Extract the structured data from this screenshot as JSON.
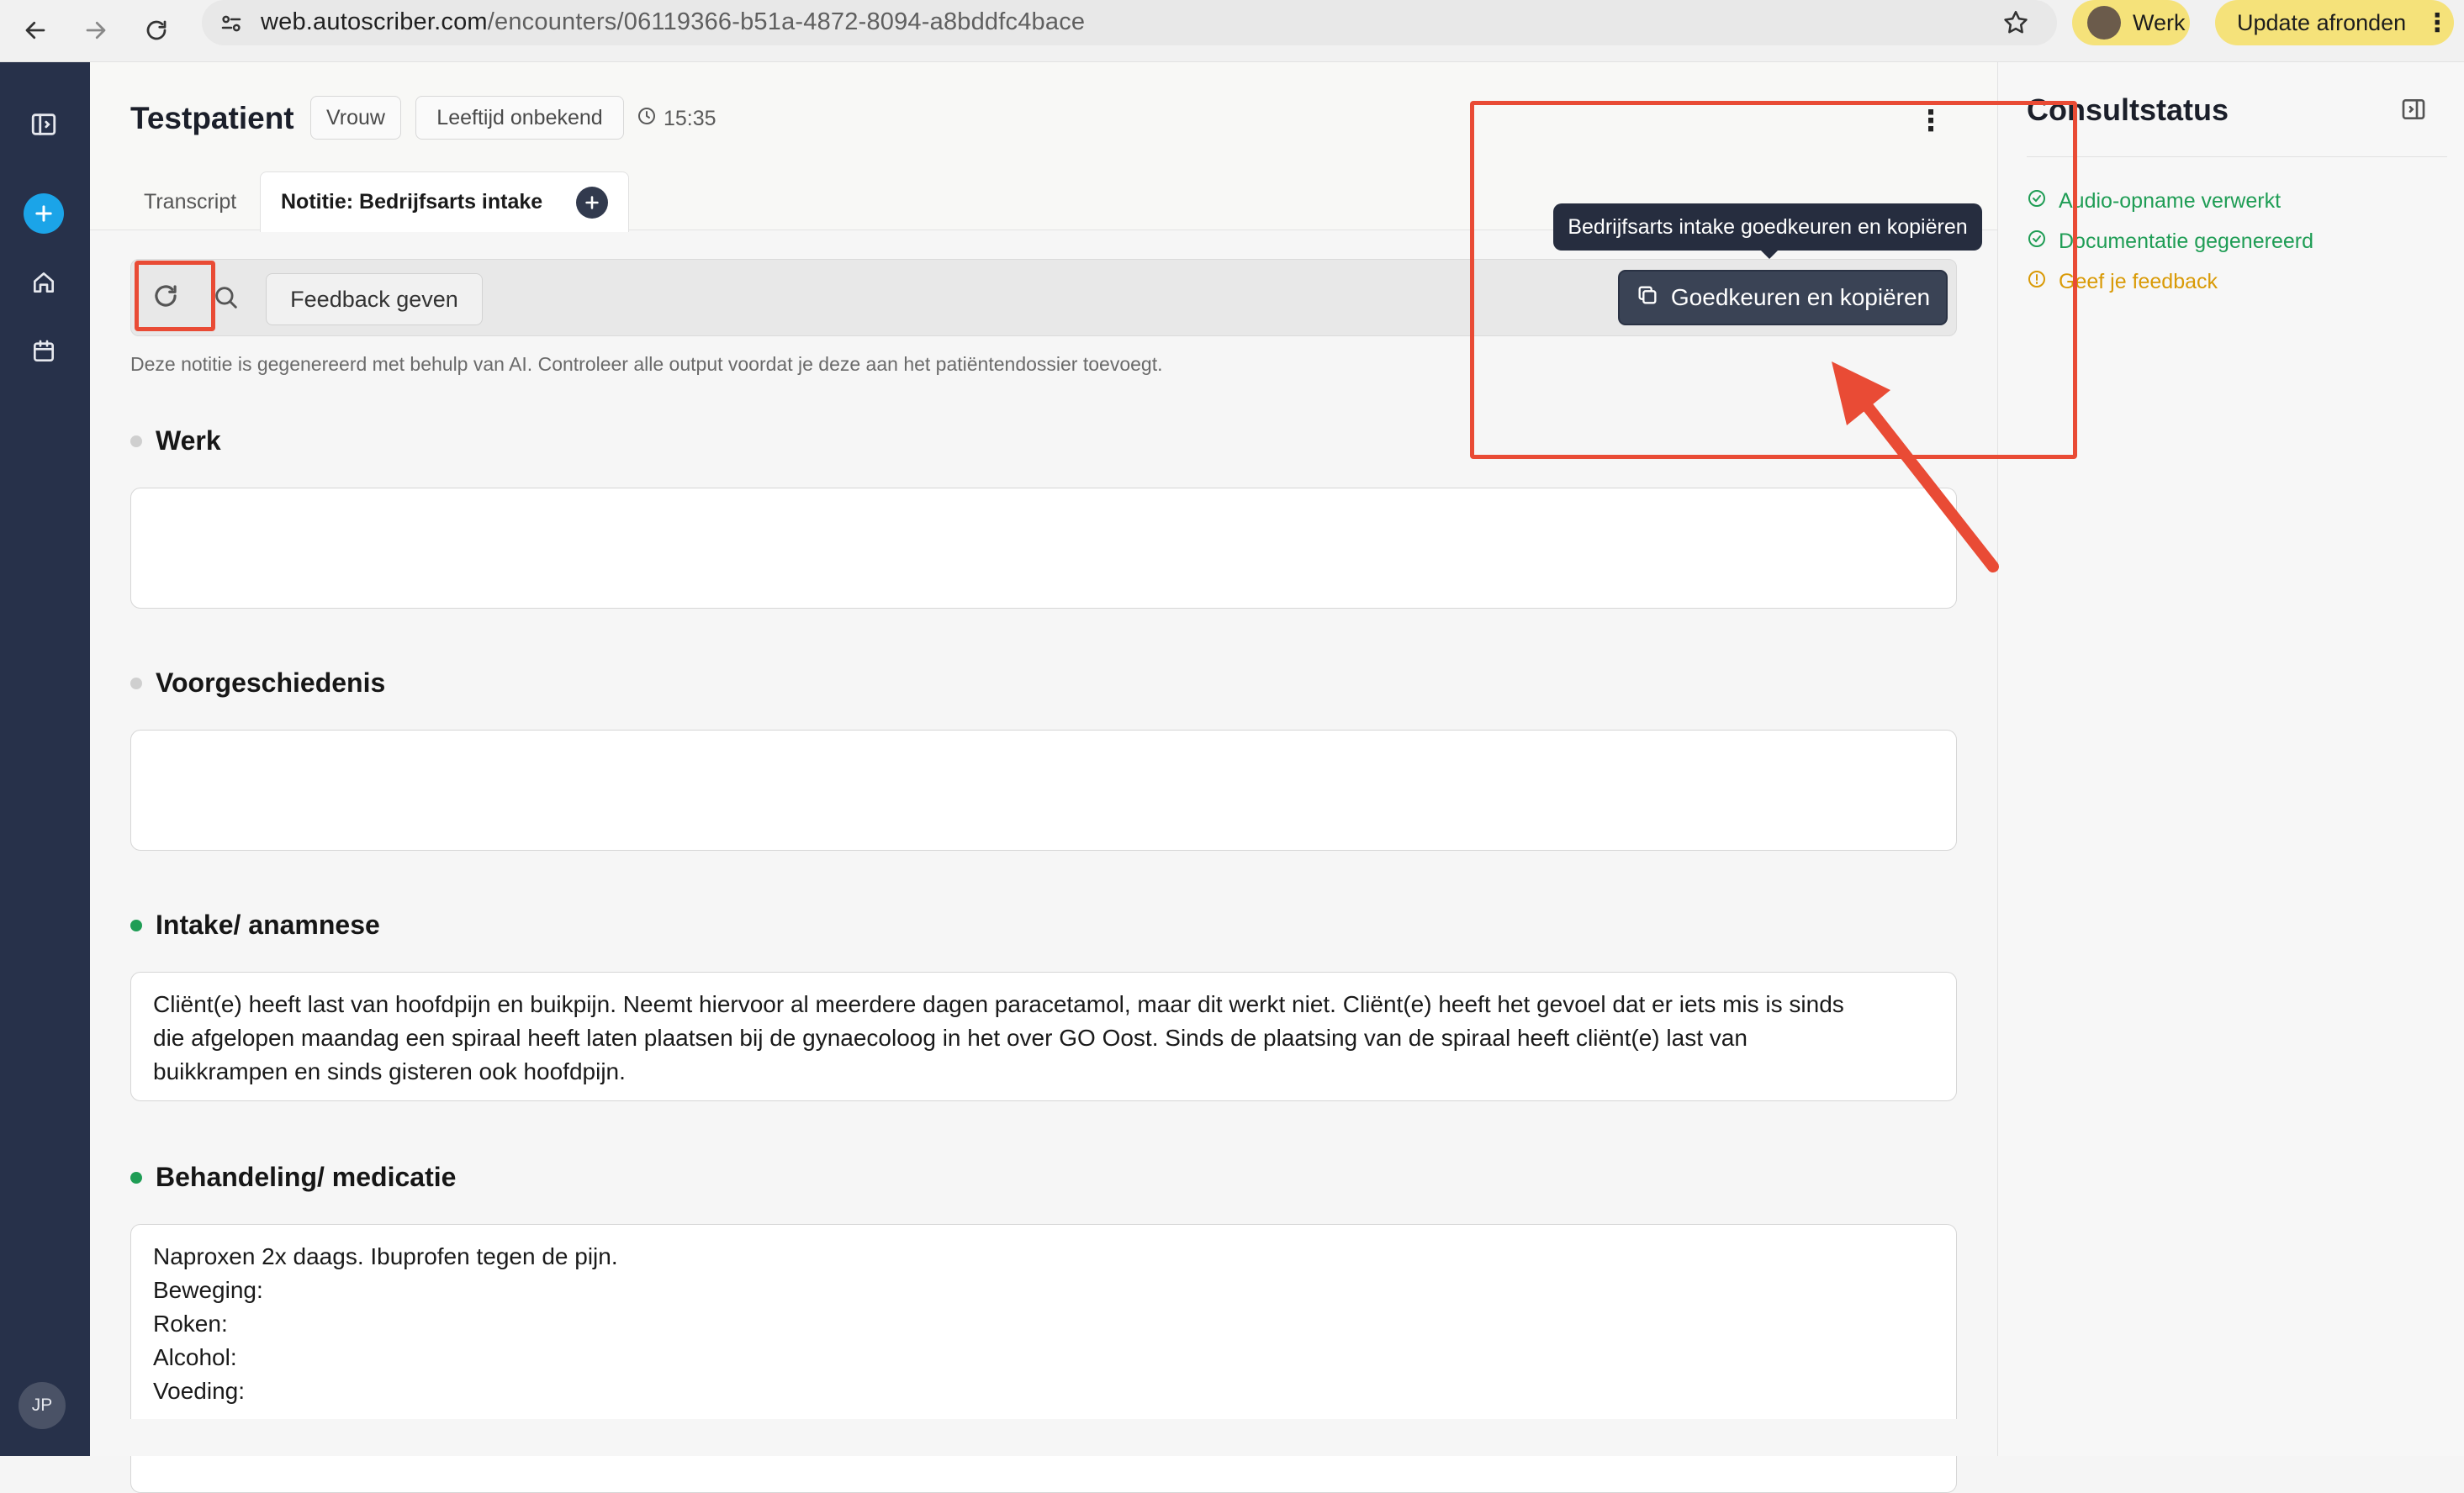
{
  "browser": {
    "url_host": "web.autoscriber.com",
    "url_path": "/encounters/06119366-b51a-4872-8094-a8bddfc4bace",
    "profile_label": "Werk",
    "update_label": "Update afronden"
  },
  "rail": {
    "avatar_initials": "JP"
  },
  "patient": {
    "name": "Testpatient",
    "gender": "Vrouw",
    "age": "Leeftijd onbekend",
    "time": "15:35"
  },
  "tabs": [
    {
      "label": "Transcript"
    },
    {
      "label": "Notitie: Bedrijfsarts intake"
    }
  ],
  "toolbar": {
    "feedback_label": "Feedback geven",
    "approve_label": "Goedkeuren en kopiëren",
    "tooltip": "Bedrijfsarts intake goedkeuren en kopiëren"
  },
  "disclaimer": "Deze notitie is gegenereerd met behulp van AI. Controleer alle output voordat je deze aan het patiëntendossier toevoegt.",
  "sections": [
    {
      "title": "Werk",
      "status": "empty",
      "lines": []
    },
    {
      "title": "Voorgeschiedenis",
      "status": "empty",
      "lines": []
    },
    {
      "title": "Intake/ anamnese",
      "status": "filled",
      "lines": [
        "Cliënt(e) heeft last van hoofdpijn en buikpijn. Neemt hiervoor al meerdere dagen paracetamol, maar dit werkt niet. Cliënt(e) heeft het gevoel dat er iets mis is sinds",
        "die afgelopen maandag een spiraal heeft laten plaatsen bij de gynaecoloog in het over GO Oost. Sinds de plaatsing van de spiraal heeft cliënt(e) last van",
        "buikkrampen en sinds gisteren ook hoofdpijn."
      ]
    },
    {
      "title": "Behandeling/ medicatie",
      "status": "filled",
      "lines": [
        "Naproxen 2x daags. Ibuprofen tegen de pijn.",
        "Beweging:",
        "Roken:",
        "Alcohol:",
        "Voeding:"
      ]
    }
  ],
  "consult_status": {
    "title": "Consultstatus",
    "items": [
      {
        "label": "Audio-opname verwerkt",
        "state": "done"
      },
      {
        "label": "Documentatie gegenereerd",
        "state": "done"
      },
      {
        "label": "Geef je feedback",
        "state": "pending"
      }
    ]
  },
  "colors": {
    "rail": "#27314a",
    "done": "#1f9d55",
    "pending": "#d99a06",
    "annotation": "#e94b35"
  }
}
